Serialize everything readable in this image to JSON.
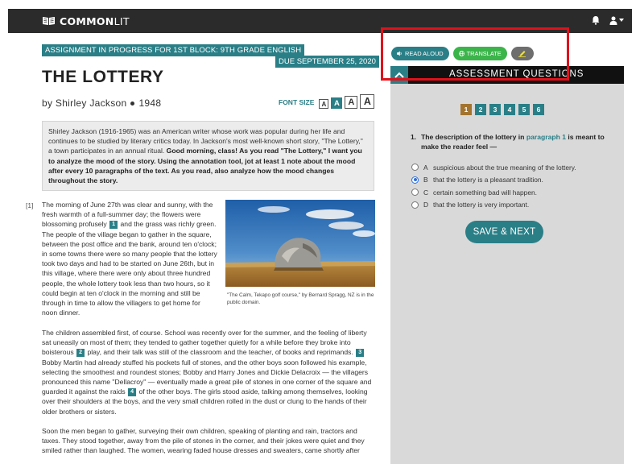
{
  "header": {
    "logo_bold": "COMMON",
    "logo_light": "LIT",
    "icons": [
      "book-icon",
      "bell-icon",
      "user-icon",
      "caret-down-icon"
    ]
  },
  "assignment": {
    "banner": "ASSIGNMENT IN PROGRESS FOR 1ST BLOCK: 9TH GRADE ENGLISH",
    "due": "DUE SEPTEMBER 25, 2020"
  },
  "text": {
    "title": "THE LOTTERY",
    "author": "by Shirley Jackson",
    "year": "1948",
    "font_size_label": "FONT SIZE",
    "font_size_options": [
      "A",
      "A",
      "A",
      "A"
    ],
    "intro_plain": "Shirley Jackson (1916-1965) was an American writer whose work was popular during her life and continues to be studied by literary critics today. In Jackson's most well-known short story, \"The Lottery,\" a town participates in an annual ritual. ",
    "intro_bold": "Good morning, class! As you read \"The Lottery,\" I want you to analyze the mood of the story. Using the annotation tool, jot at least 1 note about the mood after every 10 paragraphs of the text. As you read, also analyze how the mood changes throughout the story.",
    "para_number": "[1]",
    "para1_a": "The morning of June 27th was clear and sunny, with the fresh warmth of a full-summer day; the flowers were blossoming profusely",
    "para1_m1": "1",
    "para1_b": "and the grass was richly green. The people of the village began to gather in the square, between the post office and the bank, around ten o'clock; in some towns there were so many people that the lottery took two days and had to be started on June 26th, but in this village, where there were only about three hundred people, the whole lottery took less than two hours, so it could begin at ten o'clock in the morning and still be through in time to allow the villagers to get home for noon dinner.",
    "para2_a": "The children assembled first, of course. School was recently over for the summer, and the feeling of liberty sat uneasily on most of them; they tended to gather together quietly for a while before they broke into boisterous",
    "para2_m2": "2",
    "para2_b": "play, and their talk was still of the classroom and the teacher, of books and reprimands.",
    "para2_m3": "3",
    "para2_c": "Bobby Martin had already stuffed his pockets full of stones, and the other boys soon followed his example, selecting the smoothest and roundest stones; Bobby and Harry Jones and Dickie Delacroix — the villagers pronounced this name \"Dellacroy\" — eventually made a great pile of stones in one corner of the square and guarded it against the raids",
    "para2_m4": "4",
    "para2_d": "of the other boys. The girls stood aside, talking among themselves, looking over their shoulders at the boys, and the very small children rolled in the dust or clung to the hands of their older brothers or sisters.",
    "para3": "Soon the men began to gather, surveying their own children, speaking of planting and rain, tractors and taxes. They stood together, away from the pile of stones in the corner, and their jokes were quiet and they smiled rather than laughed. The women, wearing faded house dresses and sweaters, came shortly after",
    "image_caption": "\"The Calm, Tekapo golf course,\" by Bernard Spragg, NZ is in the public domain."
  },
  "tools": {
    "read_aloud": "READ ALOUD",
    "translate": "TRANSLATE",
    "highlight_icon": "highlighter-icon"
  },
  "assessment": {
    "title": "ASSESSMENT QUESTIONS",
    "question_nav": [
      "1",
      "2",
      "3",
      "4",
      "5",
      "6"
    ],
    "current_question": "1",
    "question_number": "1.",
    "question_text_a": "The description of the lottery in",
    "question_link": "paragraph 1",
    "question_text_b": "is meant to make the reader feel —",
    "choices": [
      {
        "letter": "A",
        "text": "suspicious about the true meaning of the lottery."
      },
      {
        "letter": "B",
        "text": "that the lottery is a pleasant tradition."
      },
      {
        "letter": "C",
        "text": "certain something bad will happen."
      },
      {
        "letter": "D",
        "text": "that the lottery is very important."
      }
    ],
    "selected_choice": "B",
    "save_button": "SAVE & NEXT"
  },
  "colors": {
    "teal": "#2a7f87",
    "green": "#3bb54a",
    "current_question": "#a3742f",
    "highlight_box": "#e0111b",
    "topbar": "#2b2b2b"
  }
}
